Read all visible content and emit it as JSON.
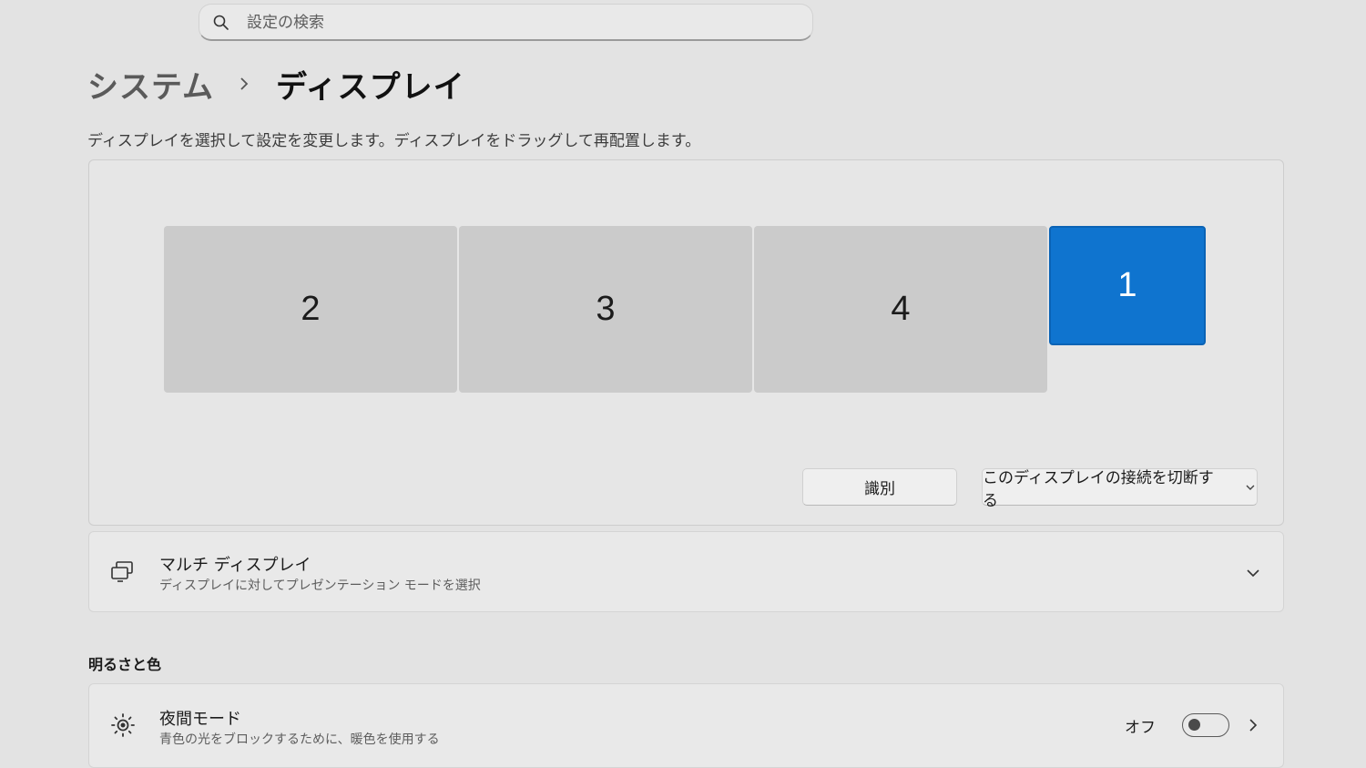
{
  "search": {
    "placeholder": "設定の検索",
    "icon": "search-icon"
  },
  "breadcrumb": {
    "parent": "システム",
    "current": "ディスプレイ"
  },
  "description": "ディスプレイを選択して設定を変更します。ディスプレイをドラッグして再配置します。",
  "displays": [
    {
      "id": "2",
      "selected": false
    },
    {
      "id": "3",
      "selected": false
    },
    {
      "id": "4",
      "selected": false
    },
    {
      "id": "1",
      "selected": true
    }
  ],
  "buttons": {
    "identify": "識別",
    "disconnect": "このディスプレイの接続を切断する"
  },
  "multi_display": {
    "title": "マルチ ディスプレイ",
    "subtitle": "ディスプレイに対してプレゼンテーション モードを選択",
    "icon": "multi-display-icon"
  },
  "section_brightness": "明るさと色",
  "night_light": {
    "title": "夜間モード",
    "subtitle": "青色の光をブロックするために、暖色を使用する",
    "state": "オフ",
    "icon": "brightness-icon"
  },
  "colors": {
    "accent": "#0f74cf",
    "background": "#e3e3e3",
    "monitor": "#cbcbcb"
  }
}
